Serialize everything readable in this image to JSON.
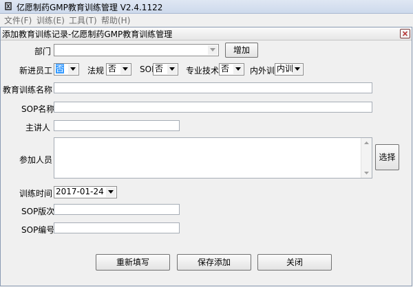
{
  "app": {
    "title": "亿愿制药GMP教育训练管理 V2.4.1122",
    "menu": [
      "文件(F)",
      "训练(E)",
      "工具(T)",
      "帮助(H)"
    ]
  },
  "dialog": {
    "title": "添加教育训练记录-亿愿制药GMP教育训练管理",
    "fields": {
      "department_label": "部门",
      "department_value": "",
      "add_button": "增加",
      "new_employee_label": "新进员工",
      "new_employee_value": "否",
      "regulation_label": "法规",
      "regulation_value": "否",
      "sop_label": "SOP",
      "sop_value": "否",
      "professional_label": "专业技术",
      "professional_value": "否",
      "internal_external_label": "内外训",
      "internal_external_value": "内训",
      "training_name_label": "教育训练名称",
      "training_name_value": "",
      "sop_name_label": "SOP名称",
      "sop_name_value": "",
      "speaker_label": "主讲人",
      "speaker_value": "",
      "participants_label": "参加人员",
      "participants_value": "",
      "select_button": "选择",
      "training_time_label": "训练时间",
      "training_time_value": "2017-01-24",
      "sop_version_label": "SOP版次",
      "sop_version_value": "",
      "sop_number_label": "SOP编号",
      "sop_number_value": ""
    },
    "buttons": {
      "reset": "重新填写",
      "save": "保存添加",
      "close": "关闭"
    }
  },
  "colors": {
    "selection": "#3399ff",
    "close_icon": "#b83b3b"
  },
  "icons": [
    "app-logo-icon",
    "close-icon",
    "chevron-down-icon",
    "scroll-up-icon",
    "scroll-down-icon"
  ]
}
